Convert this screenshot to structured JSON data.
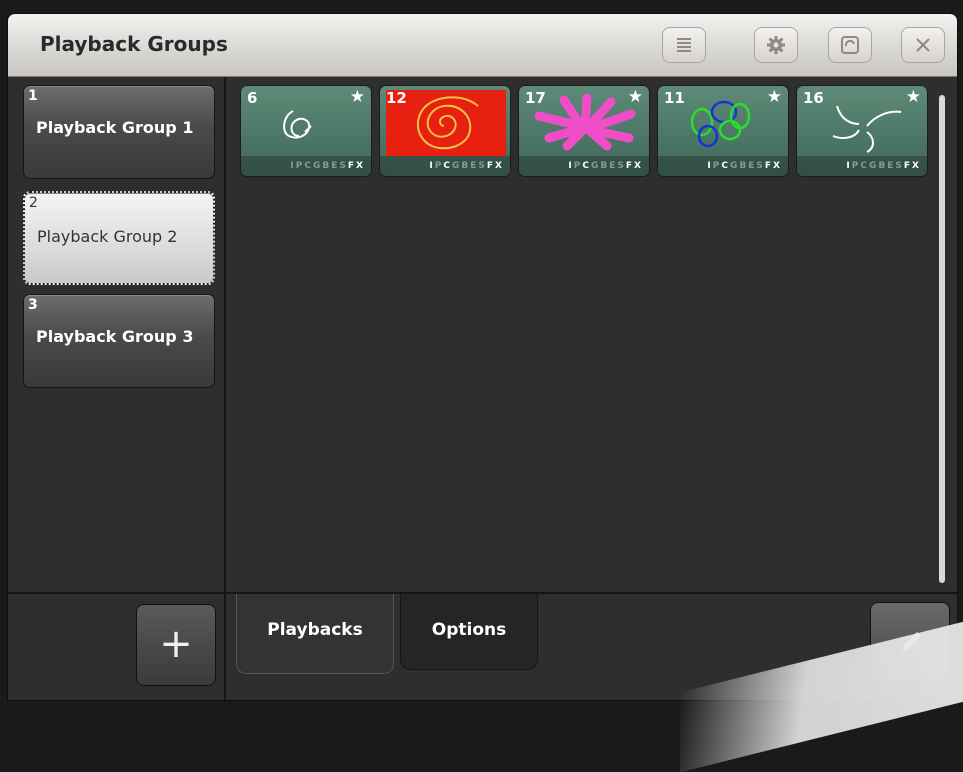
{
  "window": {
    "title": "Playback Groups"
  },
  "titlebar": {
    "buttons": [
      {
        "icon": "list-icon"
      },
      {
        "icon": "gear-icon"
      },
      {
        "icon": "fullscreen-icon"
      },
      {
        "icon": "close-icon"
      }
    ]
  },
  "groups": [
    {
      "number": "1",
      "name": "Playback Group 1",
      "selected": false
    },
    {
      "number": "2",
      "name": "Playback Group 2",
      "selected": true
    },
    {
      "number": "3",
      "name": "Playback Group 3",
      "selected": false
    }
  ],
  "playbacks": [
    {
      "number": "6",
      "star": "★",
      "attrs": [
        "I",
        "P",
        "C",
        "G",
        "B",
        "E",
        "S",
        "FX"
      ],
      "active": [
        "FX"
      ]
    },
    {
      "number": "12",
      "star": "",
      "attrs": [
        "I",
        "P",
        "C",
        "G",
        "B",
        "E",
        "S",
        "FX"
      ],
      "active": [
        "I",
        "C",
        "FX"
      ]
    },
    {
      "number": "17",
      "star": "★",
      "attrs": [
        "I",
        "P",
        "C",
        "G",
        "B",
        "E",
        "S",
        "FX"
      ],
      "active": [
        "I",
        "C",
        "FX"
      ]
    },
    {
      "number": "11",
      "star": "★",
      "attrs": [
        "I",
        "P",
        "C",
        "G",
        "B",
        "E",
        "S",
        "FX"
      ],
      "active": [
        "I",
        "C",
        "FX"
      ]
    },
    {
      "number": "16",
      "star": "★",
      "attrs": [
        "I",
        "P",
        "C",
        "G",
        "B",
        "E",
        "S",
        "FX"
      ],
      "active": [
        "I",
        "FX"
      ]
    }
  ],
  "bottom": {
    "add_label": "+",
    "tabs": [
      {
        "label": "Playbacks",
        "active": true
      },
      {
        "label": "Options",
        "active": false
      }
    ]
  }
}
